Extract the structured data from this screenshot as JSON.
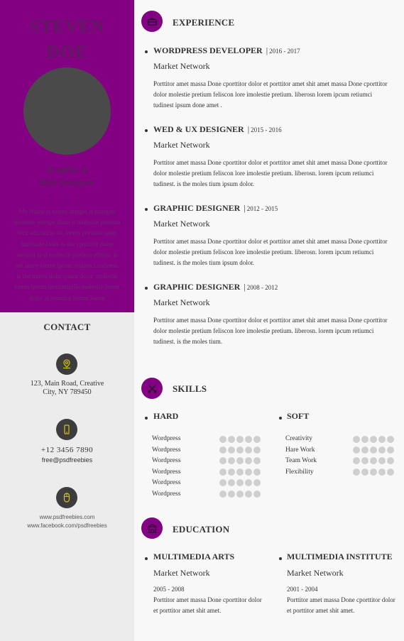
{
  "profile": {
    "first_name": "STEVEN",
    "last_name": "DOE",
    "role_line1": "Graphic &",
    "role_line2": "Web Designer",
    "dots": "• • •",
    "bio": "My Name is lorem amppte is mitrgitu molestie etempe diam is molestie pretium tecn adicasirin sit. lorem porttitor ateet barotasle Done is the cportitor dolor meaunt acul molestie pretium eftrusi. is the shary lorem ipcum retiumci tudinest. is the moles tium ipsum dolor. molestie lorem ipsum tecunntigille molestie lorem dolor at porttitor ipsum lorem"
  },
  "contact": {
    "title": "CONTACT",
    "address_line1": "123, Main Road, Creative",
    "address_line2": "City, NY 789450",
    "phone": "+12  3456  7890",
    "email": "free@psdfreebies",
    "web1": "www.psdfreebies.com",
    "web2": "www.facebook.com/psdfreebies",
    "icons": [
      "location-pin-icon",
      "phone-icon",
      "mouse-icon"
    ]
  },
  "experience": {
    "title": "EXPERIENCE",
    "icon": "briefcase-icon",
    "jobs": [
      {
        "title": "WORDPRESS DEVELOPER",
        "sep": "|",
        "years": "2016 - 2017",
        "company": "Market Network",
        "desc": "Porttitor amet massa Done cporttitor dolor et porttitor amet shit amet massa Done cporttitor dolor molestie pretium feliscon lore imolestie pretium. liberosn lorem ipcum retiumci tudinest ipsum done amet ."
      },
      {
        "title": "WED & UX DESIGNER",
        "sep": "|",
        "years": "2015 - 2016",
        "company": "Market Network",
        "desc": "Porttitor amet massa Done cporttitor dolor et porttitor amet shit amet massa Done cporttitor dolor molestie pretium feliscon lore imolestie pretium. liberosn. lorem ipcum retiumci tudinest. is the moles tium ipsum dolor."
      },
      {
        "title": "GRAPHIC DESIGNER",
        "sep": "|",
        "years": "2012 - 2015",
        "company": "Market Network",
        "desc": "Porttitor amet massa Done cporttitor dolor et porttitor amet shit amet massa Done cporttitor dolor molestie pretium feliscon lore imolestie pretium. liberosn. lorem ipcum retiumci tudinest. is the moles tium ipsum dolor."
      },
      {
        "title": "GRAPHIC DESIGNER",
        "sep": "|",
        "years": "2008 - 2012",
        "company": "Market Network",
        "desc": "Porttitor amet massa Done cporttitor dolor et porttitor amet shit amet massa Done cporttitor dolor molestie pretium feliscon lore imolestie pretium. liberosn. lorem ipcum retiumci tudinest. is the moles tium."
      }
    ]
  },
  "skills": {
    "title": "SKILLS",
    "icon": "tools-icon",
    "hard": {
      "title": "HARD",
      "items": [
        {
          "label": "Wordpress",
          "filled": 0
        },
        {
          "label": "Wordpress",
          "filled": 0
        },
        {
          "label": "Wordpress",
          "filled": 0
        },
        {
          "label": "Wordpress",
          "filled": 0
        },
        {
          "label": "Wordpress",
          "filled": 0
        },
        {
          "label": "Wordpress",
          "filled": 0
        }
      ]
    },
    "soft": {
      "title": "SOFT",
      "items": [
        {
          "label": "Creativity",
          "filled": 0
        },
        {
          "label": "Hare Work",
          "filled": 0
        },
        {
          "label": "Team Work",
          "filled": 0
        },
        {
          "label": "Flexibility",
          "filled": 0
        }
      ]
    },
    "max_rating": 5
  },
  "education": {
    "title": "EDUCATION",
    "icon": "building-icon",
    "items": [
      {
        "title": "MULTIMEDIA ARTS",
        "company": "Market Network",
        "years": "2005 - 2008",
        "desc": "Porttitor amet massa Done cporttitor dolor et porttitor amet shit amet."
      },
      {
        "title": "MULTIMEDIA INSTITUTE",
        "company": "Market Network",
        "years": "2001 - 2004",
        "desc": "Porttitor amet massa Done cporttitor dolor et porttitor amet shit amet."
      }
    ]
  },
  "colors": {
    "accent": "#830083",
    "sidebar_light": "#ececec",
    "dark_circle": "#3d3d3d",
    "contact_icon": "#d6c313",
    "rating_empty": "#cfcfcf"
  }
}
